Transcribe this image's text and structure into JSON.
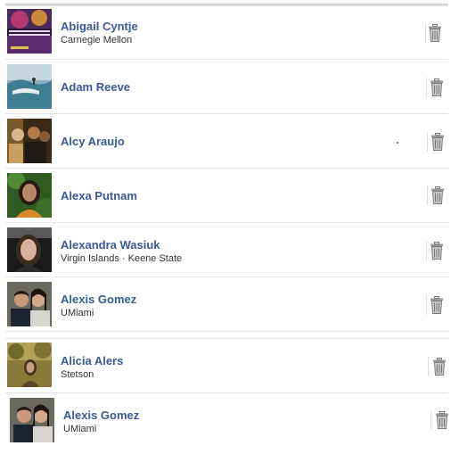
{
  "friends": [
    {
      "name": "Abigail Cyntje",
      "network": "Carnegie Mellon",
      "avatar_icon": "jazz-poster-photo"
    },
    {
      "name": "Adam Reeve",
      "network": "",
      "avatar_icon": "surfing-photo"
    },
    {
      "name": "Alcy Araujo",
      "network": "",
      "avatar_icon": "group-photo"
    },
    {
      "name": "Alexa Putnam",
      "network": "",
      "avatar_icon": "portrait-photo"
    },
    {
      "name": "Alexandra Wasiuk",
      "network": "Virgin Islands · Keene State",
      "avatar_icon": "car-portrait-photo"
    },
    {
      "name": "Alexis Gomez",
      "network": "UMiami",
      "avatar_icon": "couple-photo"
    },
    {
      "name": "Alicia Alers",
      "network": "Stetson",
      "avatar_icon": "outdoor-photo"
    },
    {
      "name": "Alexis Gomez",
      "network": "UMiami",
      "avatar_icon": "couple-photo"
    }
  ],
  "actions": {
    "remove_icon": "trash-icon"
  },
  "colors": {
    "name_link": "#3b5998",
    "network_text": "#333333",
    "divider": "#e4e4e4"
  }
}
